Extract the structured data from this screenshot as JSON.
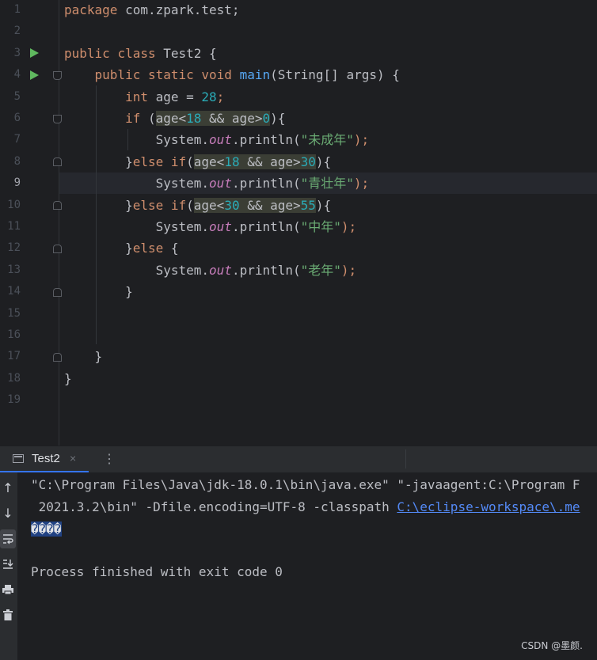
{
  "editor": {
    "line_numbers": [
      "1",
      "2",
      "3",
      "4",
      "5",
      "6",
      "7",
      "8",
      "9",
      "10",
      "11",
      "12",
      "13",
      "14",
      "15",
      "16",
      "17",
      "18",
      "19"
    ],
    "code": {
      "l1": {
        "kw": "package",
        "rest": " com.zpark.test;"
      },
      "l3": {
        "kw1": "public",
        "kw2": "class",
        "name": " Test2 {"
      },
      "l4": {
        "kw1": "public",
        "kw2": "static",
        "kw3": "void",
        "fn": "main",
        "rest": "(String[] args) {"
      },
      "l5": {
        "kw": "int",
        "a": " age = ",
        "num": "28",
        "semi": ";"
      },
      "l6": {
        "kw": "if",
        "open": " (",
        "var1": "age<",
        "n1": "18",
        "and": " && ",
        "var2": "age>",
        "n2": "0",
        "close": "){"
      },
      "l7": {
        "sys": "System.",
        "out": "out",
        "call": ".println(",
        "str": "\"未成年\"",
        "end": ");"
      },
      "l8": {
        "brace": "}",
        "kw1": "else",
        "kw2": "if",
        "open": "(",
        "var1": "age<",
        "n1": "18",
        "and": " && ",
        "var2": "age>",
        "n2": "30",
        "close": "){"
      },
      "l9": {
        "sys": "System.",
        "out": "out",
        "call": ".println(",
        "str": "\"青壮年\"",
        "end": ");"
      },
      "l10": {
        "brace": "}",
        "kw1": "else",
        "kw2": "if",
        "open": "(",
        "var1": "age<",
        "n1": "30",
        "and": " && ",
        "var2": "age>",
        "n2": "55",
        "close": "){"
      },
      "l11": {
        "sys": "System.",
        "out": "out",
        "call": ".println(",
        "str": "\"中年\"",
        "end": ");"
      },
      "l12": {
        "brace": "}",
        "kw": "else",
        "rest": " {"
      },
      "l13": {
        "sys": "System.",
        "out": "out",
        "call": ".println(",
        "str": "\"老年\"",
        "end": ");"
      },
      "l14": "}",
      "l17": "}",
      "l18": "}"
    }
  },
  "run_panel": {
    "tab_label": "Test2",
    "tab_close": "×",
    "tab_menu": "⋮",
    "cmd_line1": "\"C:\\Program Files\\Java\\jdk-18.0.1\\bin\\java.exe\" \"-javaagent:C:\\Program F",
    "cmd_line2_prefix": " 2021.3.2\\bin\" -Dfile.encoding=UTF-8 -classpath ",
    "cmd_line2_link": "C:\\eclipse-workspace\\.me",
    "output_garbled": "����",
    "exit_message": "Process finished with exit code 0"
  },
  "toolbar_icons": [
    "arrow-up-icon",
    "arrow-down-icon",
    "soft-wrap-icon",
    "scroll-to-end-icon",
    "print-icon",
    "trash-icon"
  ],
  "watermark": "CSDN @墨颜."
}
